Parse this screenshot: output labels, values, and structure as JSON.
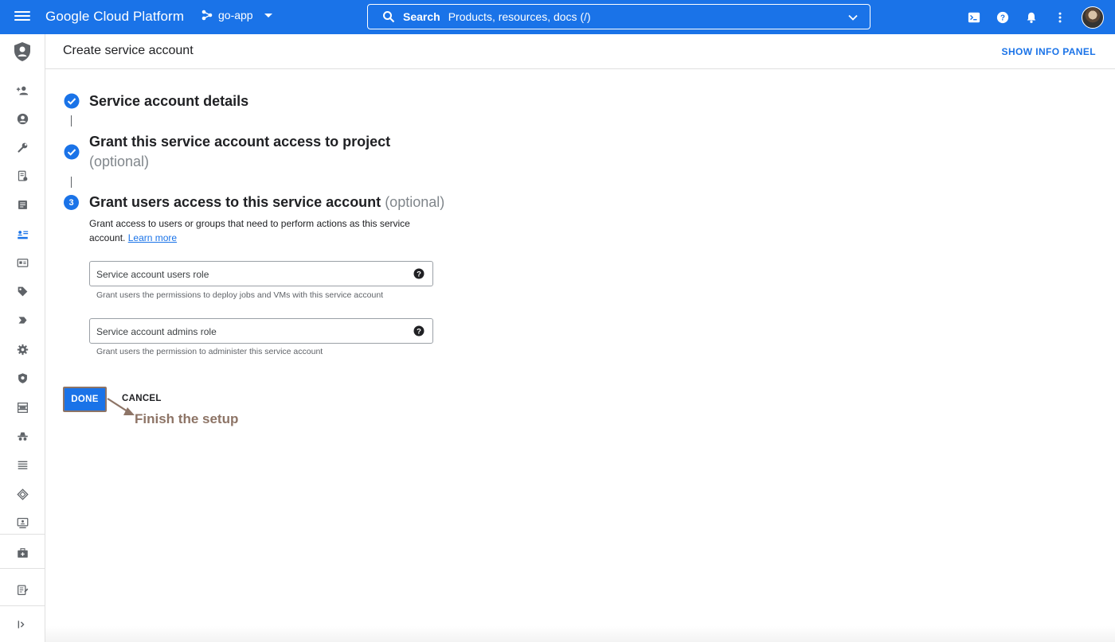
{
  "topbar": {
    "brand": "Google Cloud Platform",
    "project": "go-app",
    "search_label": "Search",
    "search_placeholder": "Products, resources, docs (/)"
  },
  "header": {
    "title": "Create service account",
    "info_panel": "SHOW INFO PANEL"
  },
  "steps": [
    {
      "title": "Service account details",
      "status": "complete"
    },
    {
      "title": "Grant this service account access to project",
      "optional": "(optional)",
      "status": "complete"
    },
    {
      "number": "3",
      "title": "Grant users access to this service account",
      "optional": "(optional)",
      "status": "active"
    }
  ],
  "step3": {
    "description": "Grant access to users or groups that need to perform actions as this service account.",
    "learn_more": "Learn more",
    "fields": [
      {
        "placeholder": "Service account users role",
        "hint": "Grant users the permissions to deploy jobs and VMs with this service account"
      },
      {
        "placeholder": "Service account admins role",
        "hint": "Grant users the permission to administer this service account"
      }
    ]
  },
  "actions": {
    "done": "DONE",
    "cancel": "CANCEL"
  },
  "annotation": {
    "text": "Finish the setup"
  },
  "rail_icons": [
    "add-person-icon",
    "account-circle-icon",
    "wrench-icon",
    "policy-doc-icon",
    "list-doc-icon",
    "service-accounts-icon",
    "id-card-icon",
    "tag-icon",
    "label-arrow-icon",
    "settings-icon",
    "shield-icon",
    "grid-list-icon",
    "incognito-icon",
    "list-icon",
    "diamond-icon",
    "display-person-icon",
    "briefcase-plus-icon",
    "edit-doc-icon",
    "expand-rail-icon"
  ],
  "colors": {
    "brand_blue": "#1a73e8",
    "annotation": "#8d7466",
    "text": "#202124",
    "muted": "#5f6368"
  }
}
